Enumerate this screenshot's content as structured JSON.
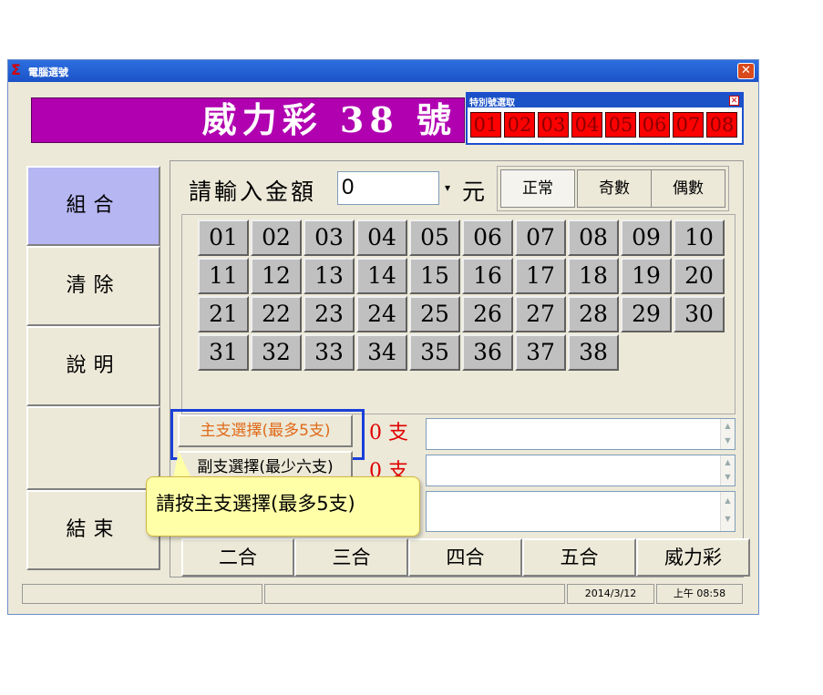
{
  "window": {
    "title": "電腦選號"
  },
  "banner": {
    "title": "威力彩 38 號"
  },
  "special_panel": {
    "title": "特別號選取",
    "numbers": [
      "01",
      "02",
      "03",
      "04",
      "05",
      "06",
      "07",
      "08"
    ]
  },
  "sidebar": {
    "items": [
      {
        "label": "組合"
      },
      {
        "label": "清除"
      },
      {
        "label": "說明"
      },
      {
        "label": ""
      },
      {
        "label": "結束"
      }
    ]
  },
  "amount": {
    "label": "請輸入金額",
    "value": "0",
    "unit": "元"
  },
  "modes": [
    {
      "label": "正常"
    },
    {
      "label": "奇數"
    },
    {
      "label": "偶數"
    }
  ],
  "numbers": [
    "01",
    "02",
    "03",
    "04",
    "05",
    "06",
    "07",
    "08",
    "09",
    "10",
    "11",
    "12",
    "13",
    "14",
    "15",
    "16",
    "17",
    "18",
    "19",
    "20",
    "21",
    "22",
    "23",
    "24",
    "25",
    "26",
    "27",
    "28",
    "29",
    "30",
    "31",
    "32",
    "33",
    "34",
    "35",
    "36",
    "37",
    "38"
  ],
  "picks": {
    "main_label": "主支選擇(最多5支)",
    "main_count": "0 支",
    "sub_label": "副支選擇(最少六支)",
    "sub_count": "0 支"
  },
  "tooltip": {
    "text": "請按主支選擇(最多5支)"
  },
  "combos": [
    {
      "label": "二合"
    },
    {
      "label": "三合"
    },
    {
      "label": "四合"
    },
    {
      "label": "五合"
    },
    {
      "label": "威力彩"
    }
  ],
  "status": {
    "date": "2014/3/12",
    "time": "上午 08:58"
  },
  "colors": {
    "banner": "#b000b0",
    "special_number_bg": "#ff0000",
    "active_sidebar": "#b6b6f2",
    "tooltip": "#ffffa8"
  }
}
